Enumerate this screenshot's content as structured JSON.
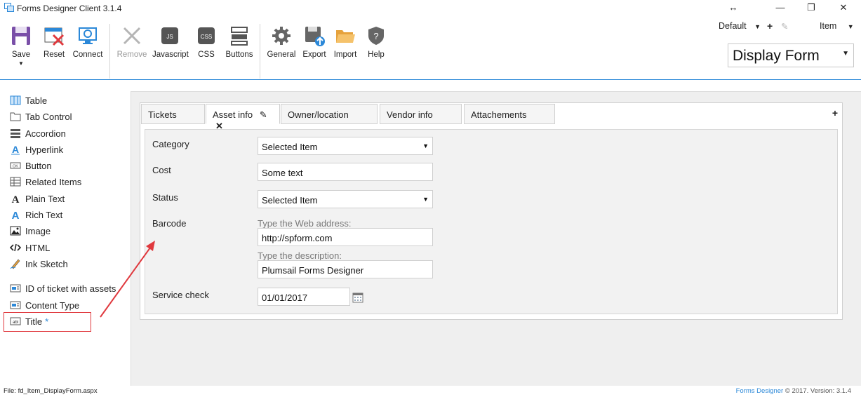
{
  "window": {
    "title": "Forms Designer Client 3.1.4",
    "controls": {
      "resize": "↔",
      "minimize": "—",
      "maximize": "❐",
      "close": "✕"
    }
  },
  "ribbon": {
    "groups": [
      {
        "buttons": [
          {
            "label": "Save",
            "icon": "save-icon"
          },
          {
            "label": "Reset",
            "icon": "reset-icon"
          },
          {
            "label": "Connect",
            "icon": "connect-icon"
          }
        ]
      },
      {
        "buttons": [
          {
            "label": "Remove",
            "icon": "remove-icon",
            "disabled": true
          },
          {
            "label": "Javascript",
            "icon": "js-icon",
            "badge": "JS"
          },
          {
            "label": "CSS",
            "icon": "css-icon",
            "badge": "CSS"
          },
          {
            "label": "Buttons",
            "icon": "buttons-icon"
          }
        ]
      },
      {
        "buttons": [
          {
            "label": "General",
            "icon": "gear-icon"
          },
          {
            "label": "Export",
            "icon": "export-icon"
          },
          {
            "label": "Import",
            "icon": "folder-icon"
          },
          {
            "label": "Help",
            "icon": "help-shield-icon"
          }
        ]
      }
    ]
  },
  "topright": {
    "layout_select": "Default",
    "content_type_select": "Item",
    "add_glyph": "+",
    "edit_glyph": "✎",
    "form_select": "Display Form"
  },
  "toolbox": {
    "items": [
      {
        "label": "Table",
        "icon": "table-icon"
      },
      {
        "label": "Tab Control",
        "icon": "tab-control-icon"
      },
      {
        "label": "Accordion",
        "icon": "accordion-icon"
      },
      {
        "label": "Hyperlink",
        "icon": "hyperlink-icon"
      },
      {
        "label": "Button",
        "icon": "button-icon"
      },
      {
        "label": "Related Items",
        "icon": "related-items-icon"
      },
      {
        "label": "Plain Text",
        "icon": "plain-text-icon"
      },
      {
        "label": "Rich Text",
        "icon": "rich-text-icon"
      },
      {
        "label": "Image",
        "icon": "image-icon"
      },
      {
        "label": "HTML",
        "icon": "html-icon"
      },
      {
        "label": "Ink Sketch",
        "icon": "ink-sketch-icon"
      }
    ],
    "fields": [
      {
        "label": "ID of ticket with assets",
        "icon": "lookup-field-icon"
      },
      {
        "label": "Content Type",
        "icon": "content-type-icon"
      },
      {
        "label": "Title",
        "icon": "text-field-icon",
        "required": "*"
      }
    ]
  },
  "tabs": {
    "items": [
      {
        "label": "Tickets"
      },
      {
        "label": "Asset info",
        "active": true
      },
      {
        "label": "Owner/location"
      },
      {
        "label": "Vendor info"
      },
      {
        "label": "Attachements"
      }
    ],
    "add": "+"
  },
  "form": {
    "category": {
      "label": "Category",
      "value": "Selected Item"
    },
    "cost": {
      "label": "Cost",
      "value": "Some text"
    },
    "status": {
      "label": "Status",
      "value": "Selected Item"
    },
    "barcode": {
      "label": "Barcode",
      "url_hint": "Type the Web address:",
      "url_value": "http://spform.com",
      "desc_hint": "Type the description:",
      "desc_value": "Plumsail Forms Designer"
    },
    "service_check": {
      "label": "Service check",
      "value": "01/01/2017"
    }
  },
  "footer": {
    "file": "File:  fd_Item_DisplayForm.aspx",
    "brand": "Forms Designer",
    "version": " © 2017. Version: 3.1.4"
  },
  "colors": {
    "accent": "#2b88d8",
    "annotation": "#e0393e"
  }
}
